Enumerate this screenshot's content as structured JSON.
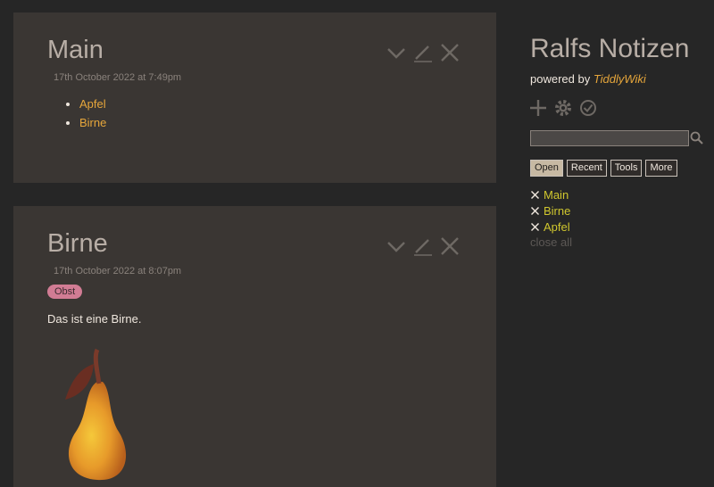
{
  "tiddlers": [
    {
      "title": "Main",
      "subtitle": "17th October 2022 at 7:49pm",
      "links": [
        "Apfel",
        "Birne"
      ]
    },
    {
      "title": "Birne",
      "subtitle": "17th October 2022 at 8:07pm",
      "tag": "Obst",
      "body": "Das ist eine Birne."
    }
  ],
  "sidebar": {
    "title": "Ralfs Notizen",
    "powered_prefix": "powered by ",
    "powered_link": "TiddlyWiki",
    "search_value": "",
    "tabs": [
      "Open",
      "Recent",
      "Tools",
      "More"
    ],
    "open_items": [
      "Main",
      "Birne",
      "Apfel"
    ],
    "close_all": "close all"
  },
  "colors": {
    "background": "#262626",
    "tiddler_bg": "#3a3633",
    "link": "#e6a63b",
    "tag_bg": "#d17c94",
    "open_item": "#d0c72e",
    "title": "#b8aea6"
  }
}
